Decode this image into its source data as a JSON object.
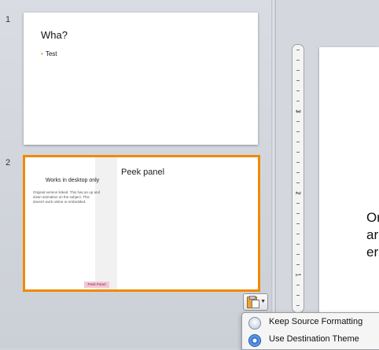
{
  "thumbnails": [
    {
      "number": "1",
      "title": "Wha?",
      "bullet": "Test"
    },
    {
      "number": "2",
      "left_heading": "Works in desktop only",
      "left_body": "Original version linked. This has an up and down animation on the subject. This doesn't work online or embedded.",
      "left_button": "Peek Panel",
      "title": "Peek panel"
    }
  ],
  "ruler": {
    "labels": [
      "3",
      "2",
      "1"
    ]
  },
  "main_slide": {
    "lines": [
      "Or",
      "ar",
      "er"
    ]
  },
  "paste_options": {
    "icon": "clipboard-paste-icon",
    "items": [
      {
        "label": "Keep Source Formatting",
        "selected": false
      },
      {
        "label": "Use Destination Theme",
        "selected": true
      }
    ]
  },
  "colors": {
    "selection": "#f08a00",
    "bullet": "#f08a00",
    "radio_selected": "#2c6fd0"
  }
}
